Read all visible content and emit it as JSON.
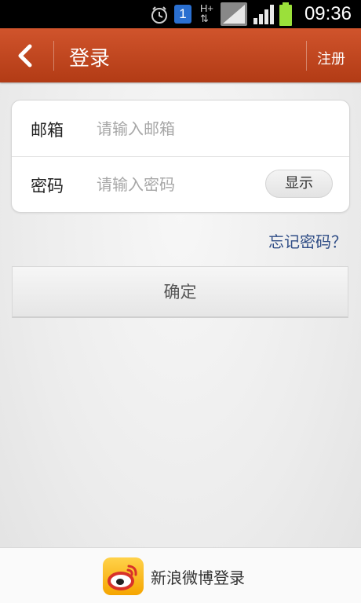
{
  "status_bar": {
    "time": "09:36",
    "icons": [
      "alarm-icon",
      "notification-1-icon",
      "hplus-data-icon",
      "wifi-signal-icon",
      "cell-signal-icon",
      "battery-icon"
    ],
    "notification_number": "1",
    "network_label": "H+"
  },
  "header": {
    "title": "登录",
    "register_label": "注册",
    "accent": "#c0461f"
  },
  "form": {
    "email_label": "邮箱",
    "email_placeholder": "请输入邮箱",
    "email_value": "",
    "password_label": "密码",
    "password_placeholder": "请输入密码",
    "password_value": "",
    "show_label": "显示"
  },
  "forgot_password": "忘记密码？",
  "confirm_label": "确定",
  "weibo_login": {
    "label": "新浪微博登录",
    "icon": "weibo-logo-icon"
  }
}
